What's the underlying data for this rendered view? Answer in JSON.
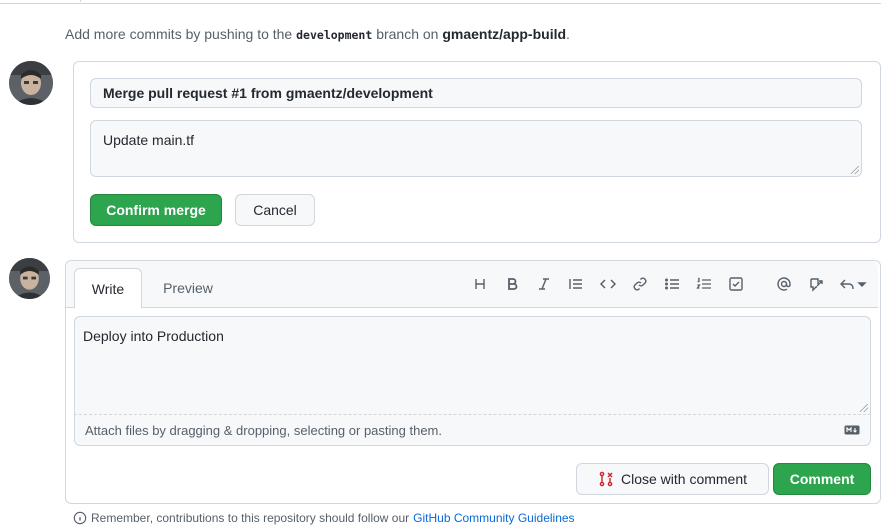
{
  "info": {
    "prefix": "Add more commits by pushing to the",
    "branch": "development",
    "middle": "branch on",
    "repo": "gmaentz/app-build",
    "suffix": "."
  },
  "merge": {
    "title_value": "Merge pull request #1 from gmaentz/development",
    "description_value": "Update main.tf",
    "confirm_label": "Confirm merge",
    "cancel_label": "Cancel"
  },
  "comment": {
    "tabs": [
      {
        "label": "Write",
        "active": true
      },
      {
        "label": "Preview",
        "active": false
      }
    ],
    "toolbar": [
      "heading-icon",
      "bold-icon",
      "italic-icon",
      "quote-icon",
      "code-icon",
      "link-icon",
      "unordered-list-icon",
      "ordered-list-icon",
      "task-list-icon",
      "mention-icon",
      "cross-reference-icon",
      "reply-icon"
    ],
    "body_value": "Deploy into Production",
    "attach_text": "Attach files by dragging & dropping, selecting or pasting them.",
    "close_label": "Close with comment",
    "comment_label": "Comment"
  },
  "reminder": {
    "text": "Remember, contributions to this repository should follow our",
    "link": "GitHub Community Guidelines"
  },
  "colors": {
    "green": "#2da44e",
    "border": "#d0d7de",
    "muted": "#57606a",
    "link": "#0969da",
    "danger": "#cf222e"
  }
}
